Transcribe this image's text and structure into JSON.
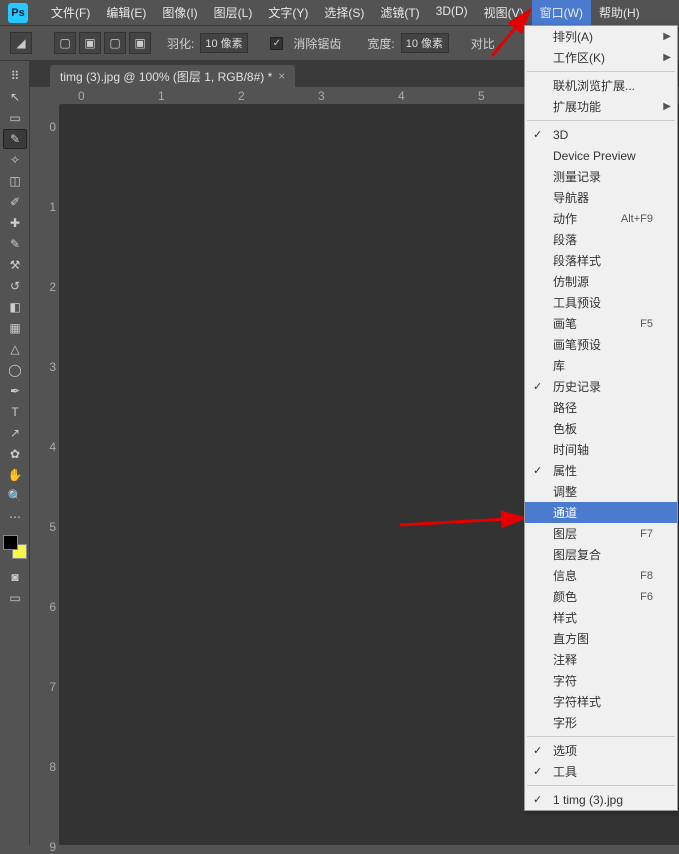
{
  "menubar": {
    "items": [
      "文件(F)",
      "编辑(E)",
      "图像(I)",
      "图层(L)",
      "文字(Y)",
      "选择(S)",
      "滤镜(T)",
      "3D(D)",
      "视图(V)",
      "窗口(W)",
      "帮助(H)"
    ],
    "active_index": 9
  },
  "optbar": {
    "feather_label": "羽化:",
    "feather_value": "10 像素",
    "antialias_label": "消除锯齿",
    "width_label": "宽度:",
    "width_value": "10 像素",
    "contrast_label": "对比"
  },
  "tab": {
    "title": "timg (3).jpg @ 100% (图层 1, RGB/8#) *",
    "close": "×"
  },
  "ruler_h": [
    "0",
    "1",
    "2",
    "3",
    "4",
    "5"
  ],
  "ruler_v": [
    "0",
    "1",
    "2",
    "3",
    "4",
    "5",
    "6",
    "7",
    "8",
    "9"
  ],
  "dropdown": {
    "items": [
      {
        "label": "排列(A)",
        "sub": true
      },
      {
        "label": "工作区(K)",
        "sub": true
      },
      {
        "sep": true
      },
      {
        "label": "联机浏览扩展..."
      },
      {
        "label": "扩展功能",
        "sub": true
      },
      {
        "sep": true
      },
      {
        "label": "3D",
        "check": true
      },
      {
        "label": "Device Preview"
      },
      {
        "label": "测量记录"
      },
      {
        "label": "导航器"
      },
      {
        "label": "动作",
        "shortcut": "Alt+F9"
      },
      {
        "label": "段落"
      },
      {
        "label": "段落样式"
      },
      {
        "label": "仿制源"
      },
      {
        "label": "工具预设"
      },
      {
        "label": "画笔",
        "shortcut": "F5"
      },
      {
        "label": "画笔预设"
      },
      {
        "label": "库"
      },
      {
        "label": "历史记录",
        "check": true
      },
      {
        "label": "路径"
      },
      {
        "label": "色板"
      },
      {
        "label": "时间轴"
      },
      {
        "label": "属性",
        "check": true
      },
      {
        "label": "调整"
      },
      {
        "label": "通道",
        "highlight": true
      },
      {
        "label": "图层",
        "shortcut": "F7"
      },
      {
        "label": "图层复合"
      },
      {
        "label": "信息",
        "shortcut": "F8"
      },
      {
        "label": "颜色",
        "shortcut": "F6"
      },
      {
        "label": "样式"
      },
      {
        "label": "直方图"
      },
      {
        "label": "注释"
      },
      {
        "label": "字符"
      },
      {
        "label": "字符样式"
      },
      {
        "label": "字形"
      },
      {
        "sep": true
      },
      {
        "label": "选项",
        "check": true
      },
      {
        "label": "工具",
        "check": true
      },
      {
        "sep": true
      },
      {
        "label": "1 timg (3).jpg",
        "check": true
      }
    ]
  }
}
